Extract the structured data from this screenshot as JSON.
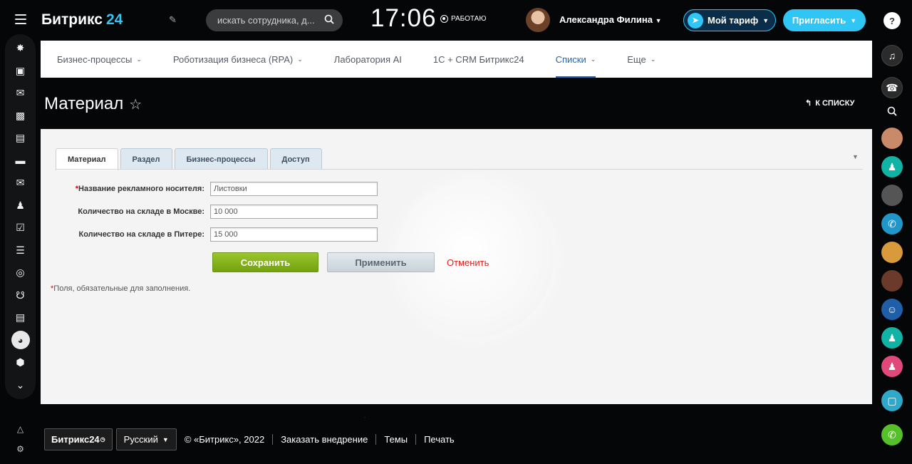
{
  "header": {
    "logo_text": "Битрикс",
    "logo_number": "24",
    "search_placeholder": "искать сотрудника, д...",
    "time": "17:06",
    "work_status": "РАБОТАЮ",
    "user_name": "Александра Филина",
    "tariff_label": "Мой тариф",
    "invite_label": "Пригласить"
  },
  "topnav": {
    "items": [
      {
        "label": "Бизнес-процессы",
        "has_chevron": true
      },
      {
        "label": "Роботизация бизнеса (RPA)",
        "has_chevron": true
      },
      {
        "label": "Лаборатория AI",
        "has_chevron": false
      },
      {
        "label": "1С + CRM Битрикс24",
        "has_chevron": false
      },
      {
        "label": "Списки",
        "has_chevron": true,
        "active": true
      },
      {
        "label": "Еще",
        "has_chevron": true
      }
    ]
  },
  "page": {
    "title": "Материал",
    "back_to_list": "К СПИСКУ"
  },
  "tabs": [
    "Материал",
    "Раздел",
    "Бизнес-процессы",
    "Доступ"
  ],
  "form": {
    "fields": [
      {
        "label": "Название рекламного носителя:",
        "required": true,
        "value": "Листовки"
      },
      {
        "label": "Количество на складе в Москве:",
        "required": false,
        "value": "10 000"
      },
      {
        "label": "Количество на складе в Питере:",
        "required": false,
        "value": "15 000"
      }
    ],
    "save_label": "Сохранить",
    "apply_label": "Применить",
    "cancel_label": "Отменить",
    "required_asterisk": "*",
    "required_note": "Поля, обязательные для заполнения."
  },
  "footer": {
    "logo_text": "Битрикс24",
    "language": "Русский",
    "copyright": "© «Битрикс», 2022",
    "links": [
      "Заказать внедрение",
      "Темы",
      "Печать"
    ]
  },
  "left_menu_icons": [
    "stream-icon",
    "tasks-icon",
    "chat-icon",
    "calendar-icon",
    "document-icon",
    "drive-icon",
    "mail-icon",
    "group-icon",
    "checklist-icon",
    "filter-icon",
    "target-icon",
    "cart-icon",
    "contact-card-icon",
    "robot-icon",
    "box-icon",
    "more-icon"
  ],
  "colors": {
    "accent": "#2fc6f6",
    "nav_active": "#2067b0",
    "save_green": "#85b31c",
    "cancel_red": "#d6271f"
  }
}
